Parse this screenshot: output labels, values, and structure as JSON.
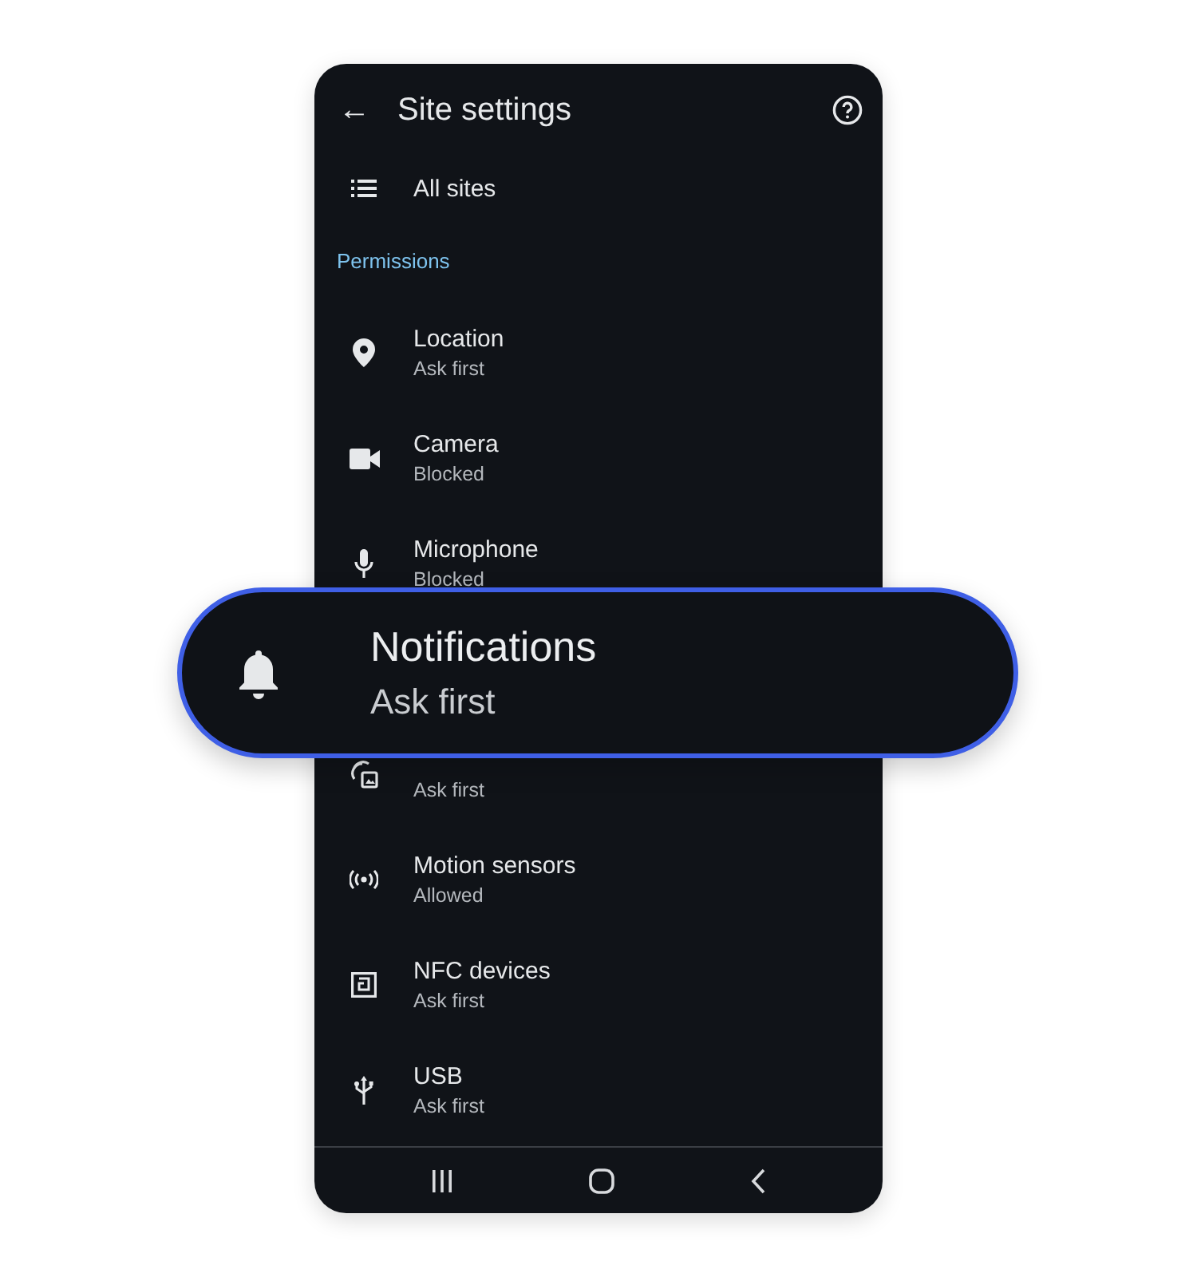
{
  "app_bar": {
    "back": "←",
    "title": "Site settings"
  },
  "all_sites": {
    "label": "All sites"
  },
  "section_header": "Permissions",
  "permissions": [
    {
      "title": "Location",
      "status": "Ask first"
    },
    {
      "title": "Camera",
      "status": "Blocked"
    },
    {
      "title": "Microphone",
      "status": "Blocked"
    },
    {
      "status": "Ask first"
    },
    {
      "title": "Motion sensors",
      "status": "Allowed"
    },
    {
      "title": "NFC devices",
      "status": "Ask first"
    },
    {
      "title": "USB",
      "status": "Ask first"
    }
  ],
  "callout": {
    "title": "Notifications",
    "status": "Ask first"
  }
}
